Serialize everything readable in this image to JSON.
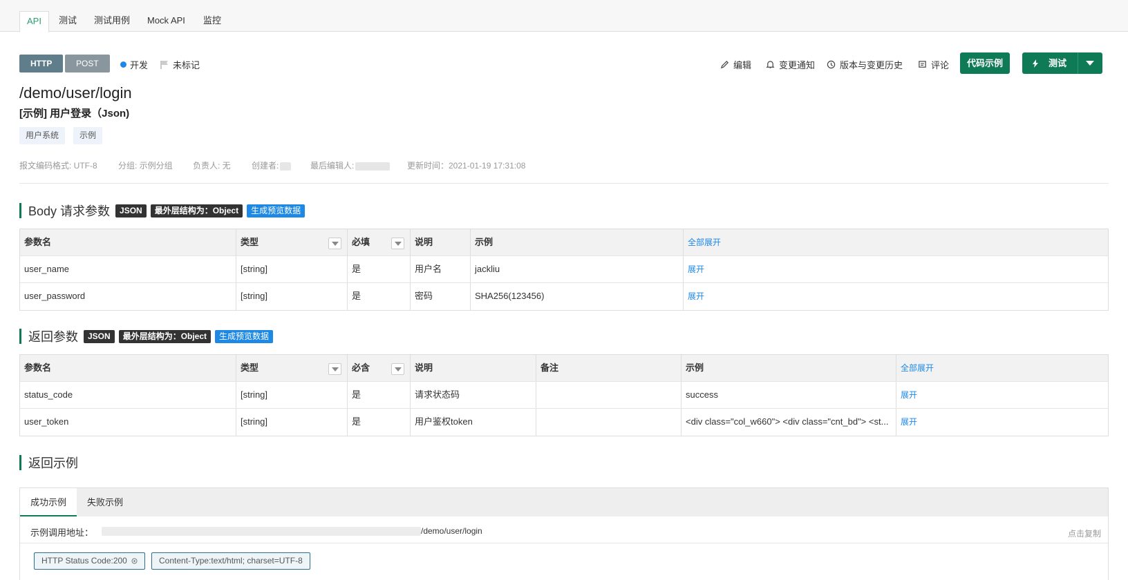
{
  "tabs": [
    "API",
    "测试",
    "测试用例",
    "Mock API",
    "监控"
  ],
  "header": {
    "protocol": "HTTP",
    "method": "POST",
    "status": "开发",
    "mark": "未标记",
    "actions": {
      "edit": "编辑",
      "notify": "变更通知",
      "history": "版本与变更历史",
      "comment": "评论",
      "code_example": "代码示例",
      "test": "测试"
    }
  },
  "api": {
    "path": "/demo/user/login",
    "title": "[示例] 用户登录（Json)",
    "tags": [
      "用户系统",
      "示例"
    ],
    "meta": {
      "encoding": "报文编码格式: UTF-8",
      "group": "分组: 示例分组",
      "owner": "负责人: 无",
      "creator": "创建者:",
      "last_editor": "最后编辑人:",
      "updated": "更新时间：2021-01-19 17:31:08"
    }
  },
  "body_section": {
    "title": "Body 请求参数",
    "badge_format": "JSON",
    "badge_structure": "最外层结构为：Object",
    "badge_generate": "生成预览数据",
    "columns": [
      "参数名",
      "类型",
      "必填",
      "说明",
      "示例",
      "全部展开"
    ],
    "rows": [
      {
        "name": "user_name",
        "type": "[string]",
        "required": "是",
        "desc": "用户名",
        "example": "jackliu",
        "action": "展开"
      },
      {
        "name": "user_password",
        "type": "[string]",
        "required": "是",
        "desc": "密码",
        "example": "SHA256(123456)",
        "action": "展开"
      }
    ]
  },
  "response_section": {
    "title": "返回参数",
    "badge_format": "JSON",
    "badge_structure": "最外层结构为：Object",
    "badge_generate": "生成预览数据",
    "columns": [
      "参数名",
      "类型",
      "必含",
      "说明",
      "备注",
      "示例",
      "全部展开"
    ],
    "rows": [
      {
        "name": "status_code",
        "type": "[string]",
        "required": "是",
        "desc": "请求状态码",
        "note": "",
        "example": "success",
        "action": "展开"
      },
      {
        "name": "user_token",
        "type": "[string]",
        "required": "是",
        "desc": "用户鉴权token",
        "note": "",
        "example": "<div class=\"col_w660\"> <div class=\"cnt_bd\"> <st...",
        "action": "展开"
      }
    ]
  },
  "examples_section": {
    "title": "返回示例",
    "tabs": [
      "成功示例",
      "失败示例"
    ],
    "url_label": "示例调用地址：",
    "url_suffix": "/demo/user/login",
    "copy": "点击复制",
    "status_chip": "HTTP Status Code:200",
    "content_type_chip": "Content-Type:text/html; charset=UTF-8"
  },
  "colors": {
    "accent": "#0f7a56",
    "link": "#1e88e5",
    "tab_active": "#2e9f6f"
  }
}
